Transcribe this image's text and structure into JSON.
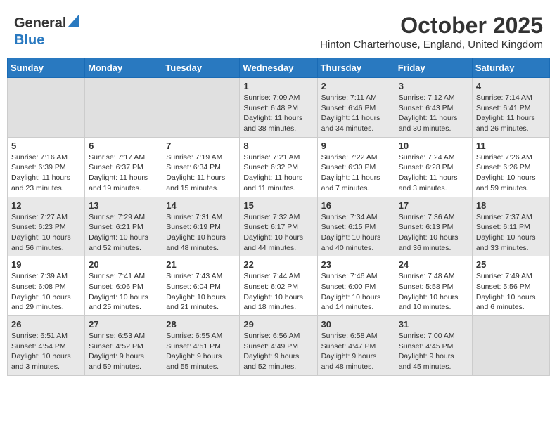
{
  "header": {
    "logo_general": "General",
    "logo_blue": "Blue",
    "month_title": "October 2025",
    "location": "Hinton Charterhouse, England, United Kingdom"
  },
  "days_of_week": [
    "Sunday",
    "Monday",
    "Tuesday",
    "Wednesday",
    "Thursday",
    "Friday",
    "Saturday"
  ],
  "weeks": [
    [
      {
        "day": "",
        "sunrise": "",
        "sunset": "",
        "daylight": "",
        "empty": true
      },
      {
        "day": "",
        "sunrise": "",
        "sunset": "",
        "daylight": "",
        "empty": true
      },
      {
        "day": "",
        "sunrise": "",
        "sunset": "",
        "daylight": "",
        "empty": true
      },
      {
        "day": "1",
        "sunrise": "Sunrise: 7:09 AM",
        "sunset": "Sunset: 6:48 PM",
        "daylight": "Daylight: 11 hours and 38 minutes."
      },
      {
        "day": "2",
        "sunrise": "Sunrise: 7:11 AM",
        "sunset": "Sunset: 6:46 PM",
        "daylight": "Daylight: 11 hours and 34 minutes."
      },
      {
        "day": "3",
        "sunrise": "Sunrise: 7:12 AM",
        "sunset": "Sunset: 6:43 PM",
        "daylight": "Daylight: 11 hours and 30 minutes."
      },
      {
        "day": "4",
        "sunrise": "Sunrise: 7:14 AM",
        "sunset": "Sunset: 6:41 PM",
        "daylight": "Daylight: 11 hours and 26 minutes."
      }
    ],
    [
      {
        "day": "5",
        "sunrise": "Sunrise: 7:16 AM",
        "sunset": "Sunset: 6:39 PM",
        "daylight": "Daylight: 11 hours and 23 minutes."
      },
      {
        "day": "6",
        "sunrise": "Sunrise: 7:17 AM",
        "sunset": "Sunset: 6:37 PM",
        "daylight": "Daylight: 11 hours and 19 minutes."
      },
      {
        "day": "7",
        "sunrise": "Sunrise: 7:19 AM",
        "sunset": "Sunset: 6:34 PM",
        "daylight": "Daylight: 11 hours and 15 minutes."
      },
      {
        "day": "8",
        "sunrise": "Sunrise: 7:21 AM",
        "sunset": "Sunset: 6:32 PM",
        "daylight": "Daylight: 11 hours and 11 minutes."
      },
      {
        "day": "9",
        "sunrise": "Sunrise: 7:22 AM",
        "sunset": "Sunset: 6:30 PM",
        "daylight": "Daylight: 11 hours and 7 minutes."
      },
      {
        "day": "10",
        "sunrise": "Sunrise: 7:24 AM",
        "sunset": "Sunset: 6:28 PM",
        "daylight": "Daylight: 11 hours and 3 minutes."
      },
      {
        "day": "11",
        "sunrise": "Sunrise: 7:26 AM",
        "sunset": "Sunset: 6:26 PM",
        "daylight": "Daylight: 10 hours and 59 minutes."
      }
    ],
    [
      {
        "day": "12",
        "sunrise": "Sunrise: 7:27 AM",
        "sunset": "Sunset: 6:23 PM",
        "daylight": "Daylight: 10 hours and 56 minutes."
      },
      {
        "day": "13",
        "sunrise": "Sunrise: 7:29 AM",
        "sunset": "Sunset: 6:21 PM",
        "daylight": "Daylight: 10 hours and 52 minutes."
      },
      {
        "day": "14",
        "sunrise": "Sunrise: 7:31 AM",
        "sunset": "Sunset: 6:19 PM",
        "daylight": "Daylight: 10 hours and 48 minutes."
      },
      {
        "day": "15",
        "sunrise": "Sunrise: 7:32 AM",
        "sunset": "Sunset: 6:17 PM",
        "daylight": "Daylight: 10 hours and 44 minutes."
      },
      {
        "day": "16",
        "sunrise": "Sunrise: 7:34 AM",
        "sunset": "Sunset: 6:15 PM",
        "daylight": "Daylight: 10 hours and 40 minutes."
      },
      {
        "day": "17",
        "sunrise": "Sunrise: 7:36 AM",
        "sunset": "Sunset: 6:13 PM",
        "daylight": "Daylight: 10 hours and 36 minutes."
      },
      {
        "day": "18",
        "sunrise": "Sunrise: 7:37 AM",
        "sunset": "Sunset: 6:11 PM",
        "daylight": "Daylight: 10 hours and 33 minutes."
      }
    ],
    [
      {
        "day": "19",
        "sunrise": "Sunrise: 7:39 AM",
        "sunset": "Sunset: 6:08 PM",
        "daylight": "Daylight: 10 hours and 29 minutes."
      },
      {
        "day": "20",
        "sunrise": "Sunrise: 7:41 AM",
        "sunset": "Sunset: 6:06 PM",
        "daylight": "Daylight: 10 hours and 25 minutes."
      },
      {
        "day": "21",
        "sunrise": "Sunrise: 7:43 AM",
        "sunset": "Sunset: 6:04 PM",
        "daylight": "Daylight: 10 hours and 21 minutes."
      },
      {
        "day": "22",
        "sunrise": "Sunrise: 7:44 AM",
        "sunset": "Sunset: 6:02 PM",
        "daylight": "Daylight: 10 hours and 18 minutes."
      },
      {
        "day": "23",
        "sunrise": "Sunrise: 7:46 AM",
        "sunset": "Sunset: 6:00 PM",
        "daylight": "Daylight: 10 hours and 14 minutes."
      },
      {
        "day": "24",
        "sunrise": "Sunrise: 7:48 AM",
        "sunset": "Sunset: 5:58 PM",
        "daylight": "Daylight: 10 hours and 10 minutes."
      },
      {
        "day": "25",
        "sunrise": "Sunrise: 7:49 AM",
        "sunset": "Sunset: 5:56 PM",
        "daylight": "Daylight: 10 hours and 6 minutes."
      }
    ],
    [
      {
        "day": "26",
        "sunrise": "Sunrise: 6:51 AM",
        "sunset": "Sunset: 4:54 PM",
        "daylight": "Daylight: 10 hours and 3 minutes."
      },
      {
        "day": "27",
        "sunrise": "Sunrise: 6:53 AM",
        "sunset": "Sunset: 4:52 PM",
        "daylight": "Daylight: 9 hours and 59 minutes."
      },
      {
        "day": "28",
        "sunrise": "Sunrise: 6:55 AM",
        "sunset": "Sunset: 4:51 PM",
        "daylight": "Daylight: 9 hours and 55 minutes."
      },
      {
        "day": "29",
        "sunrise": "Sunrise: 6:56 AM",
        "sunset": "Sunset: 4:49 PM",
        "daylight": "Daylight: 9 hours and 52 minutes."
      },
      {
        "day": "30",
        "sunrise": "Sunrise: 6:58 AM",
        "sunset": "Sunset: 4:47 PM",
        "daylight": "Daylight: 9 hours and 48 minutes."
      },
      {
        "day": "31",
        "sunrise": "Sunrise: 7:00 AM",
        "sunset": "Sunset: 4:45 PM",
        "daylight": "Daylight: 9 hours and 45 minutes."
      },
      {
        "day": "",
        "sunrise": "",
        "sunset": "",
        "daylight": "",
        "empty": true
      }
    ]
  ]
}
